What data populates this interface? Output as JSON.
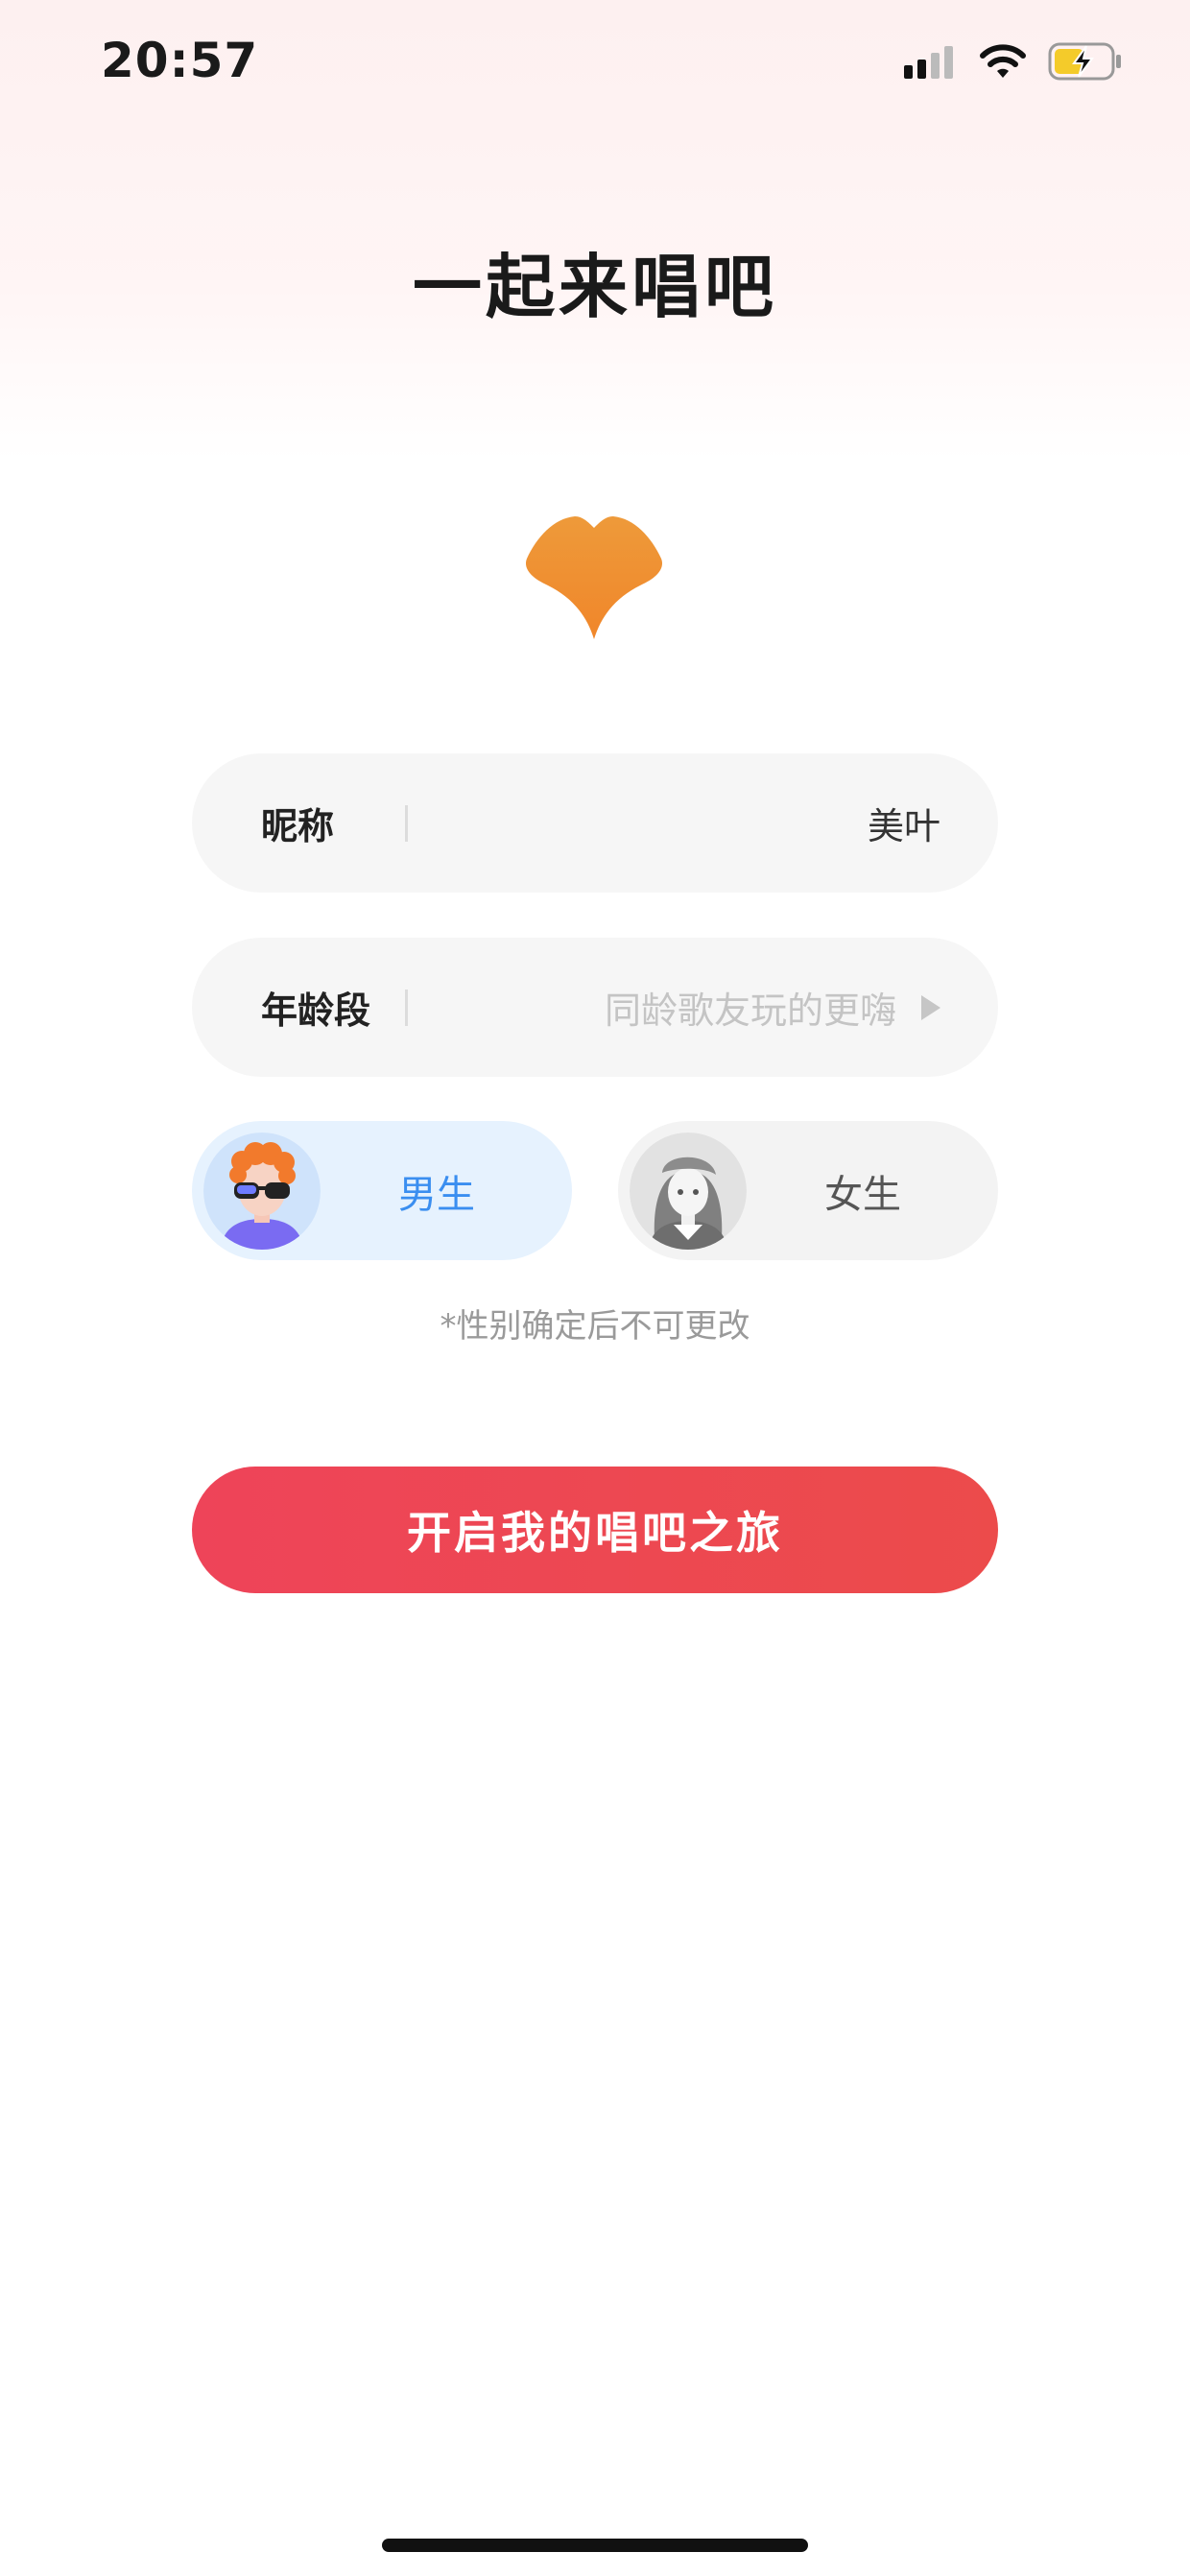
{
  "status_bar": {
    "time": "20:57"
  },
  "page": {
    "title": "一起来唱吧"
  },
  "form": {
    "nickname": {
      "label": "昵称",
      "value": "美叶"
    },
    "age": {
      "label": "年龄段",
      "placeholder": "同龄歌友玩的更嗨"
    },
    "gender": {
      "male_label": "男生",
      "female_label": "女生",
      "selected": "男生",
      "hint": "*性别确定后不可更改"
    }
  },
  "cta": {
    "label": "开启我的唱吧之旅"
  },
  "colors": {
    "accent": "#ec4656",
    "logo": "#f0932f",
    "male_selected_bg": "#e6f2fe",
    "male_label": "#3a8ef0"
  },
  "icons": [
    "cellular-signal-icon",
    "wifi-icon",
    "battery-charging-icon",
    "ginkgo-logo-icon",
    "arrow-right-icon",
    "male-avatar-icon",
    "female-avatar-icon"
  ]
}
